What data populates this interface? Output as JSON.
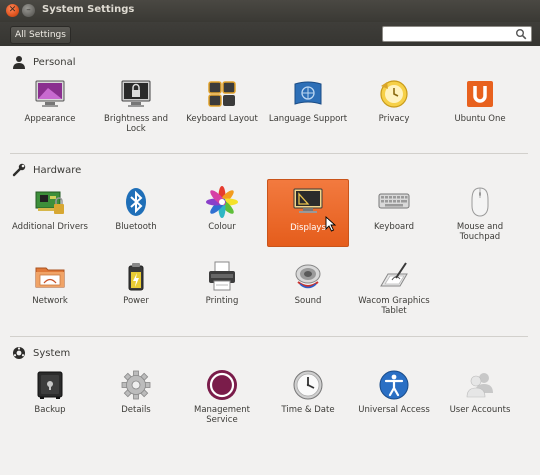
{
  "window": {
    "title": "System Settings",
    "all_settings_label": "All Settings",
    "search": {
      "placeholder": "",
      "value": ""
    }
  },
  "sections": {
    "personal": {
      "label": "Personal",
      "items": [
        "Appearance",
        "Brightness and Lock",
        "Keyboard Layout",
        "Language Support",
        "Privacy",
        "Ubuntu One"
      ]
    },
    "hardware": {
      "label": "Hardware",
      "items": [
        "Additional Drivers",
        "Bluetooth",
        "Colour",
        "Displays",
        "Keyboard",
        "Mouse and Touchpad",
        "Network",
        "Power",
        "Printing",
        "Sound",
        "Wacom Graphics Tablet"
      ]
    },
    "system": {
      "label": "System",
      "items": [
        "Backup",
        "Details",
        "Management Service",
        "Time & Date",
        "Universal Access",
        "User Accounts"
      ]
    }
  },
  "selected_item": "Displays",
  "colors": {
    "accent": "#e8611e",
    "titlebar": "#3c3b37",
    "background": "#f2f1f0"
  }
}
